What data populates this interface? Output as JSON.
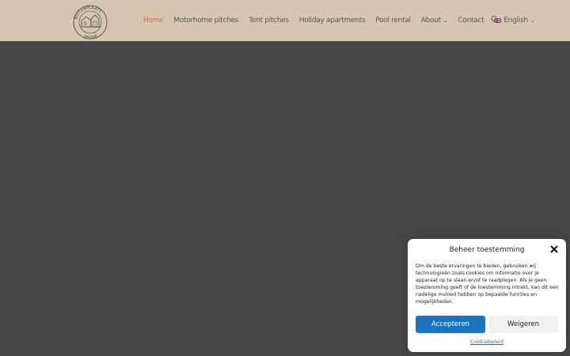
{
  "header": {
    "logo": {
      "text_top": "BUITENPLAATS",
      "text_bottom": "URETERP"
    },
    "nav": [
      {
        "label": "Home",
        "active": true,
        "dropdown": false
      },
      {
        "label": "Motorhome pitches",
        "active": false,
        "dropdown": false
      },
      {
        "label": "Tent pitches",
        "active": false,
        "dropdown": false
      },
      {
        "label": "Holiday apartments",
        "active": false,
        "dropdown": false
      },
      {
        "label": "Pool rental",
        "active": false,
        "dropdown": false
      },
      {
        "label": "About",
        "active": false,
        "dropdown": true
      },
      {
        "label": "Contact",
        "active": false,
        "dropdown": false
      },
      {
        "label": "English",
        "active": false,
        "dropdown": true,
        "flag": "uk-flag-icon"
      }
    ],
    "search_icon": "search-icon"
  },
  "consent": {
    "title": "Beheer toestemming",
    "body": "Om de beste ervaringen te bieden, gebruiken wij technologieën zoals cookies om informatie over je apparaat op te slaan en/of te raadplegen. Als je geen toestemming geeft of de toestemming intrekt, kan dit een nadelige invloed hebben op bepaalde functies en mogelijkheden.",
    "accept_label": "Accepteren",
    "deny_label": "Weigeren",
    "policy_label": "Cookiebeleid"
  },
  "colors": {
    "header_bg": "#d6c6b0",
    "nav_active": "#d16a59",
    "overlay": "#464646",
    "accent": "#1e73be"
  }
}
